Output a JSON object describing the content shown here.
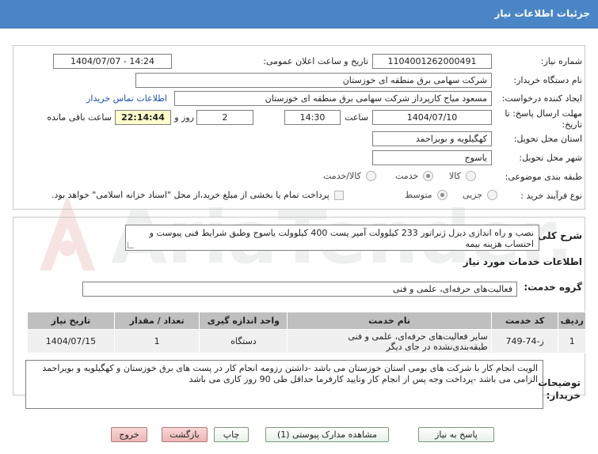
{
  "header": {
    "title": "جزئیات اطلاعات نیاز"
  },
  "watermark": {
    "text": "AriaTender.net"
  },
  "form": {
    "need_number_label": "شماره نیاز:",
    "need_number": "1104001262000491",
    "announce_label": "تاریخ و ساعت اعلان عمومی:",
    "announce_value": "1404/07/07 - 14:24",
    "buyer_label": "نام دستگاه خریدار:",
    "buyer_value": "شرکت سهامی برق منطقه ای خوزستان",
    "creator_label": "ایجاد کننده درخواست:",
    "creator_value": "مسعود میاح کارپرداز شرکت سهامی برق منطقه ای خوزستان",
    "contact_link": "اطلاعات تماس خریدار",
    "deadline_label": "مهلت ارسال پاسخ: تا تاریخ:",
    "deadline_date": "1404/07/10",
    "time_label": "ساعت",
    "deadline_time": "14:30",
    "days_value": "2",
    "days_label": "روز و",
    "remaining_time": "22:14:44",
    "remaining_label": "ساعت باقی مانده",
    "province_label": "استان محل تحویل:",
    "province_value": "کهگیلویه و بویراحمد",
    "city_label": "شهر محل تحویل:",
    "city_value": "یاسوج",
    "category_label": "طبقه بندی موضوعی:",
    "category_options": [
      "کالا",
      "خدمت",
      "کالا/خدمت"
    ],
    "category_selected": 1,
    "process_label": "نوع فرآیند خرید :",
    "process_options": [
      "جزیی",
      "متوسط"
    ],
    "process_selected": 1,
    "payment_note": "پرداخت تمام یا بخشی از مبلغ خرید،از محل \"اسناد خزانه اسلامی\" خواهد بود."
  },
  "summary": {
    "label": "شرح کلی نیاز:",
    "text": "نصب و راه اندازی دیزل ژنراتور 233 کیلوولت آمپر پست 400 کیلوولت یاسوج وطبق شرایط فنی پیوست و احتساب هزینه بیمه"
  },
  "services": {
    "title": "اطلاعات خدمات مورد نیاز",
    "group_label": "گروه خدمت:",
    "group_value": "فعالیت‌های حرفه‌ای، علمی و فنی",
    "columns": [
      "ردیف",
      "کد خدمت",
      "نام خدمت",
      "واحد اندازه گیری",
      "تعداد / مقدار",
      "تاریخ نیاز"
    ],
    "rows": [
      [
        "1",
        "ز-74-749",
        "سایر فعالیت‌های حرفه‌ای، علمی و فنی طبقه‌بندی‌نشده در جای دیگر",
        "دستگاه",
        "1",
        "1404/07/15"
      ]
    ]
  },
  "notes": {
    "label": "توضیحات خریدار:",
    "text": "الویت انجام کار با شرکت های بومی استان خوزستان می باشد -داشتن  رزومه انجام کار در پست های برق خوزستان و کهگیلویه و بویراحمد الزامی می باشد -پرداخت وجه پس از انجام کار وتایید کارفرما حداقل طی 90 روز کاری می باشد"
  },
  "buttons": {
    "reply": "پاسخ به نیاز",
    "attachments": "مشاهده مدارک پیوستی (1)",
    "print": "چاپ",
    "back": "بازگشت",
    "exit": "خروج"
  },
  "colors": {
    "header": "#4a86c5",
    "table_header": "#bfbfbf",
    "timer_bg": "#ffffcc",
    "link": "#1a4fb5"
  }
}
